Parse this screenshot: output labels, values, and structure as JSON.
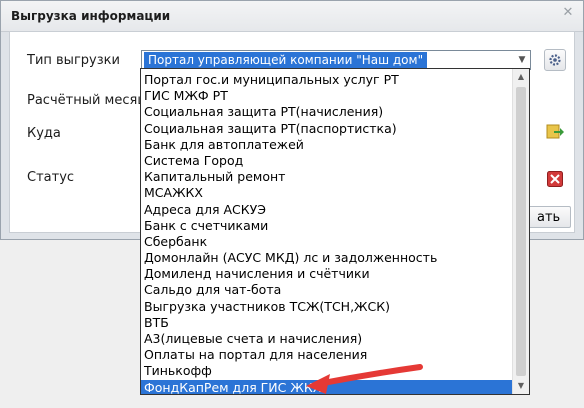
{
  "window": {
    "title": "Выгрузка информации",
    "close_icon": "close-icon"
  },
  "form": {
    "type_label": "Тип выгрузки",
    "month_label": "Расчётный месяц",
    "dest_label": "Куда",
    "status_label": "Статус",
    "type_value": "Портал управляющей компании \"Наш дом\"",
    "partial_button_label": "ать"
  },
  "icons": {
    "settings": "gear-icon",
    "folder": "folder-arrow-icon",
    "clear": "red-x-icon"
  },
  "dropdown": {
    "items": [
      "Портал гос.и муниципальных услуг РТ",
      "ГИС МЖФ РТ",
      "Социальная защита РТ(начисления)",
      "Социальная защита РТ(паспортистка)",
      "Банк для автоплатежей",
      "Система Город",
      "Капитальный ремонт",
      "МСАЖКХ",
      "Адреса для АСКУЭ",
      "Банк с счетчиками",
      "Сбербанк",
      "Домонлайн (АСУС МКД) лс и задолженность",
      "Домиленд начисления и счётчики",
      "Сальдо для чат-бота",
      "Выгрузка участников ТСЖ(ТСН,ЖСК)",
      "ВТБ",
      "А3(лицевые счета и начисления)",
      "Оплаты на портал для населения",
      "Тинькофф",
      "ФондКапРем для ГИС ЖКХ"
    ],
    "selected_index": 19
  },
  "colors": {
    "selection": "#2b74d6",
    "annotation_arrow": "#e53935"
  }
}
